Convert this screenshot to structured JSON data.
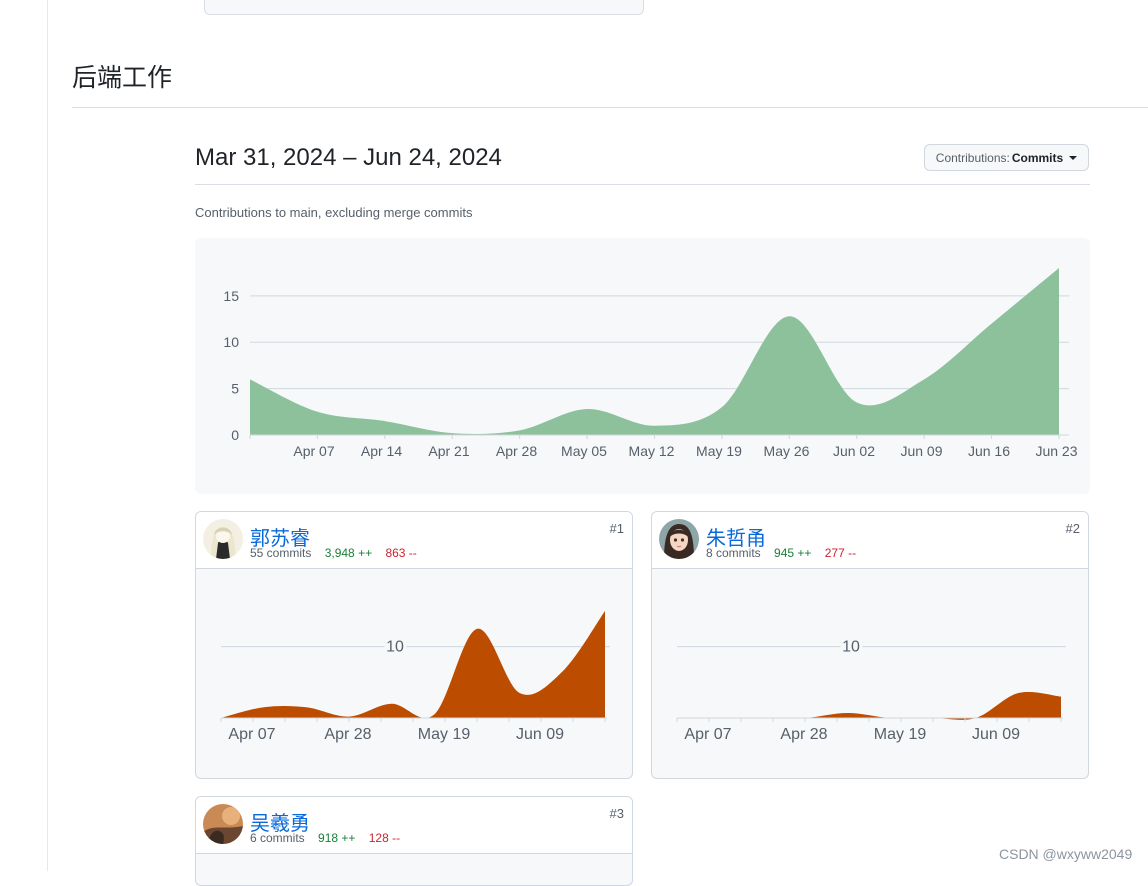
{
  "section": {
    "title": "后端工作"
  },
  "header": {
    "date_range": "Mar 31, 2024 – Jun 24, 2024",
    "contributions_prefix": "Contributions:",
    "contributions_value": "Commits",
    "subtitle": "Contributions to main, excluding merge commits"
  },
  "chart_data": [
    {
      "type": "area",
      "title": "",
      "xlabel": "",
      "ylabel": "",
      "color": "#8cc19c",
      "y_ticks": [
        "0",
        "5",
        "10",
        "15"
      ],
      "x_ticks": [
        "Apr 07",
        "Apr 14",
        "Apr 21",
        "Apr 28",
        "May 05",
        "May 12",
        "May 19",
        "May 26",
        "Jun 02",
        "Jun 09",
        "Jun 16",
        "Jun 23"
      ],
      "x": [
        "Mar 31",
        "Apr 07",
        "Apr 14",
        "Apr 21",
        "Apr 28",
        "May 05",
        "May 12",
        "May 19",
        "May 26",
        "Jun 02",
        "Jun 09",
        "Jun 16",
        "Jun 23"
      ],
      "values": [
        6,
        2.5,
        1.5,
        0.2,
        0.5,
        2.8,
        1,
        3,
        12.8,
        3.5,
        6,
        12,
        18
      ],
      "ylim": [
        0,
        18
      ],
      "grid": true
    },
    {
      "type": "area",
      "color": "#bc4c00",
      "y_ticks": [
        "10"
      ],
      "x_ticks": [
        "Apr 07",
        "Apr 28",
        "May 19",
        "Jun 09"
      ],
      "values": [
        0,
        1.5,
        1.5,
        0.2,
        2,
        0.5,
        12.5,
        3.5,
        6.5,
        15
      ],
      "ylim": [
        0,
        15
      ],
      "grid": true
    },
    {
      "type": "area",
      "color": "#bc4c00",
      "y_ticks": [
        "10"
      ],
      "x_ticks": [
        "Apr 07",
        "Apr 28",
        "May 19",
        "Jun 09"
      ],
      "values": [
        0,
        0,
        0,
        0,
        0.7,
        0,
        0,
        0,
        3.5,
        3
      ],
      "ylim": [
        0,
        15
      ],
      "grid": true
    }
  ],
  "contributors": [
    {
      "name": "郭苏睿",
      "commits": "55 commits",
      "additions": "3,948 ++",
      "deletions": "863 --",
      "rank": "#1"
    },
    {
      "name": "朱哲甬",
      "commits": "8 commits",
      "additions": "945 ++",
      "deletions": "277 --",
      "rank": "#2"
    },
    {
      "name": "吴羲勇",
      "commits": "6 commits",
      "additions": "918 ++",
      "deletions": "128 --",
      "rank": "#3"
    }
  ],
  "watermark": "CSDN @wxyww2049"
}
